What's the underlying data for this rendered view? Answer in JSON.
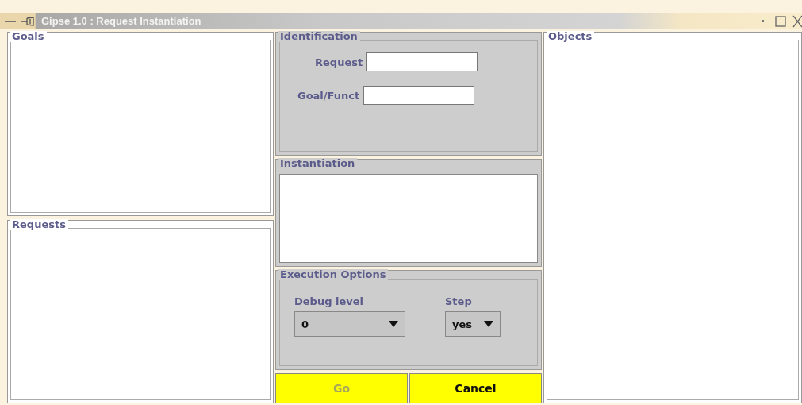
{
  "window": {
    "title": "Gipse 1.0 : Request Instantiation"
  },
  "goals": {
    "title": "Goals"
  },
  "requests": {
    "title": "Requests"
  },
  "identification": {
    "title": "Identification",
    "fields": [
      {
        "label": "Request"
      },
      {
        "label": "Goal/Funct"
      }
    ]
  },
  "instantiation": {
    "title": "Instantiation"
  },
  "execution_options": {
    "title": "Execution Options",
    "selects": [
      {
        "label": "Debug level",
        "value": "0"
      },
      {
        "label": "Step",
        "value": "yes"
      }
    ]
  },
  "buttons": [
    {
      "label": "Go",
      "disabled": true
    },
    {
      "label": "Cancel",
      "disabled": false
    }
  ],
  "objects": {
    "title": "Objects"
  }
}
